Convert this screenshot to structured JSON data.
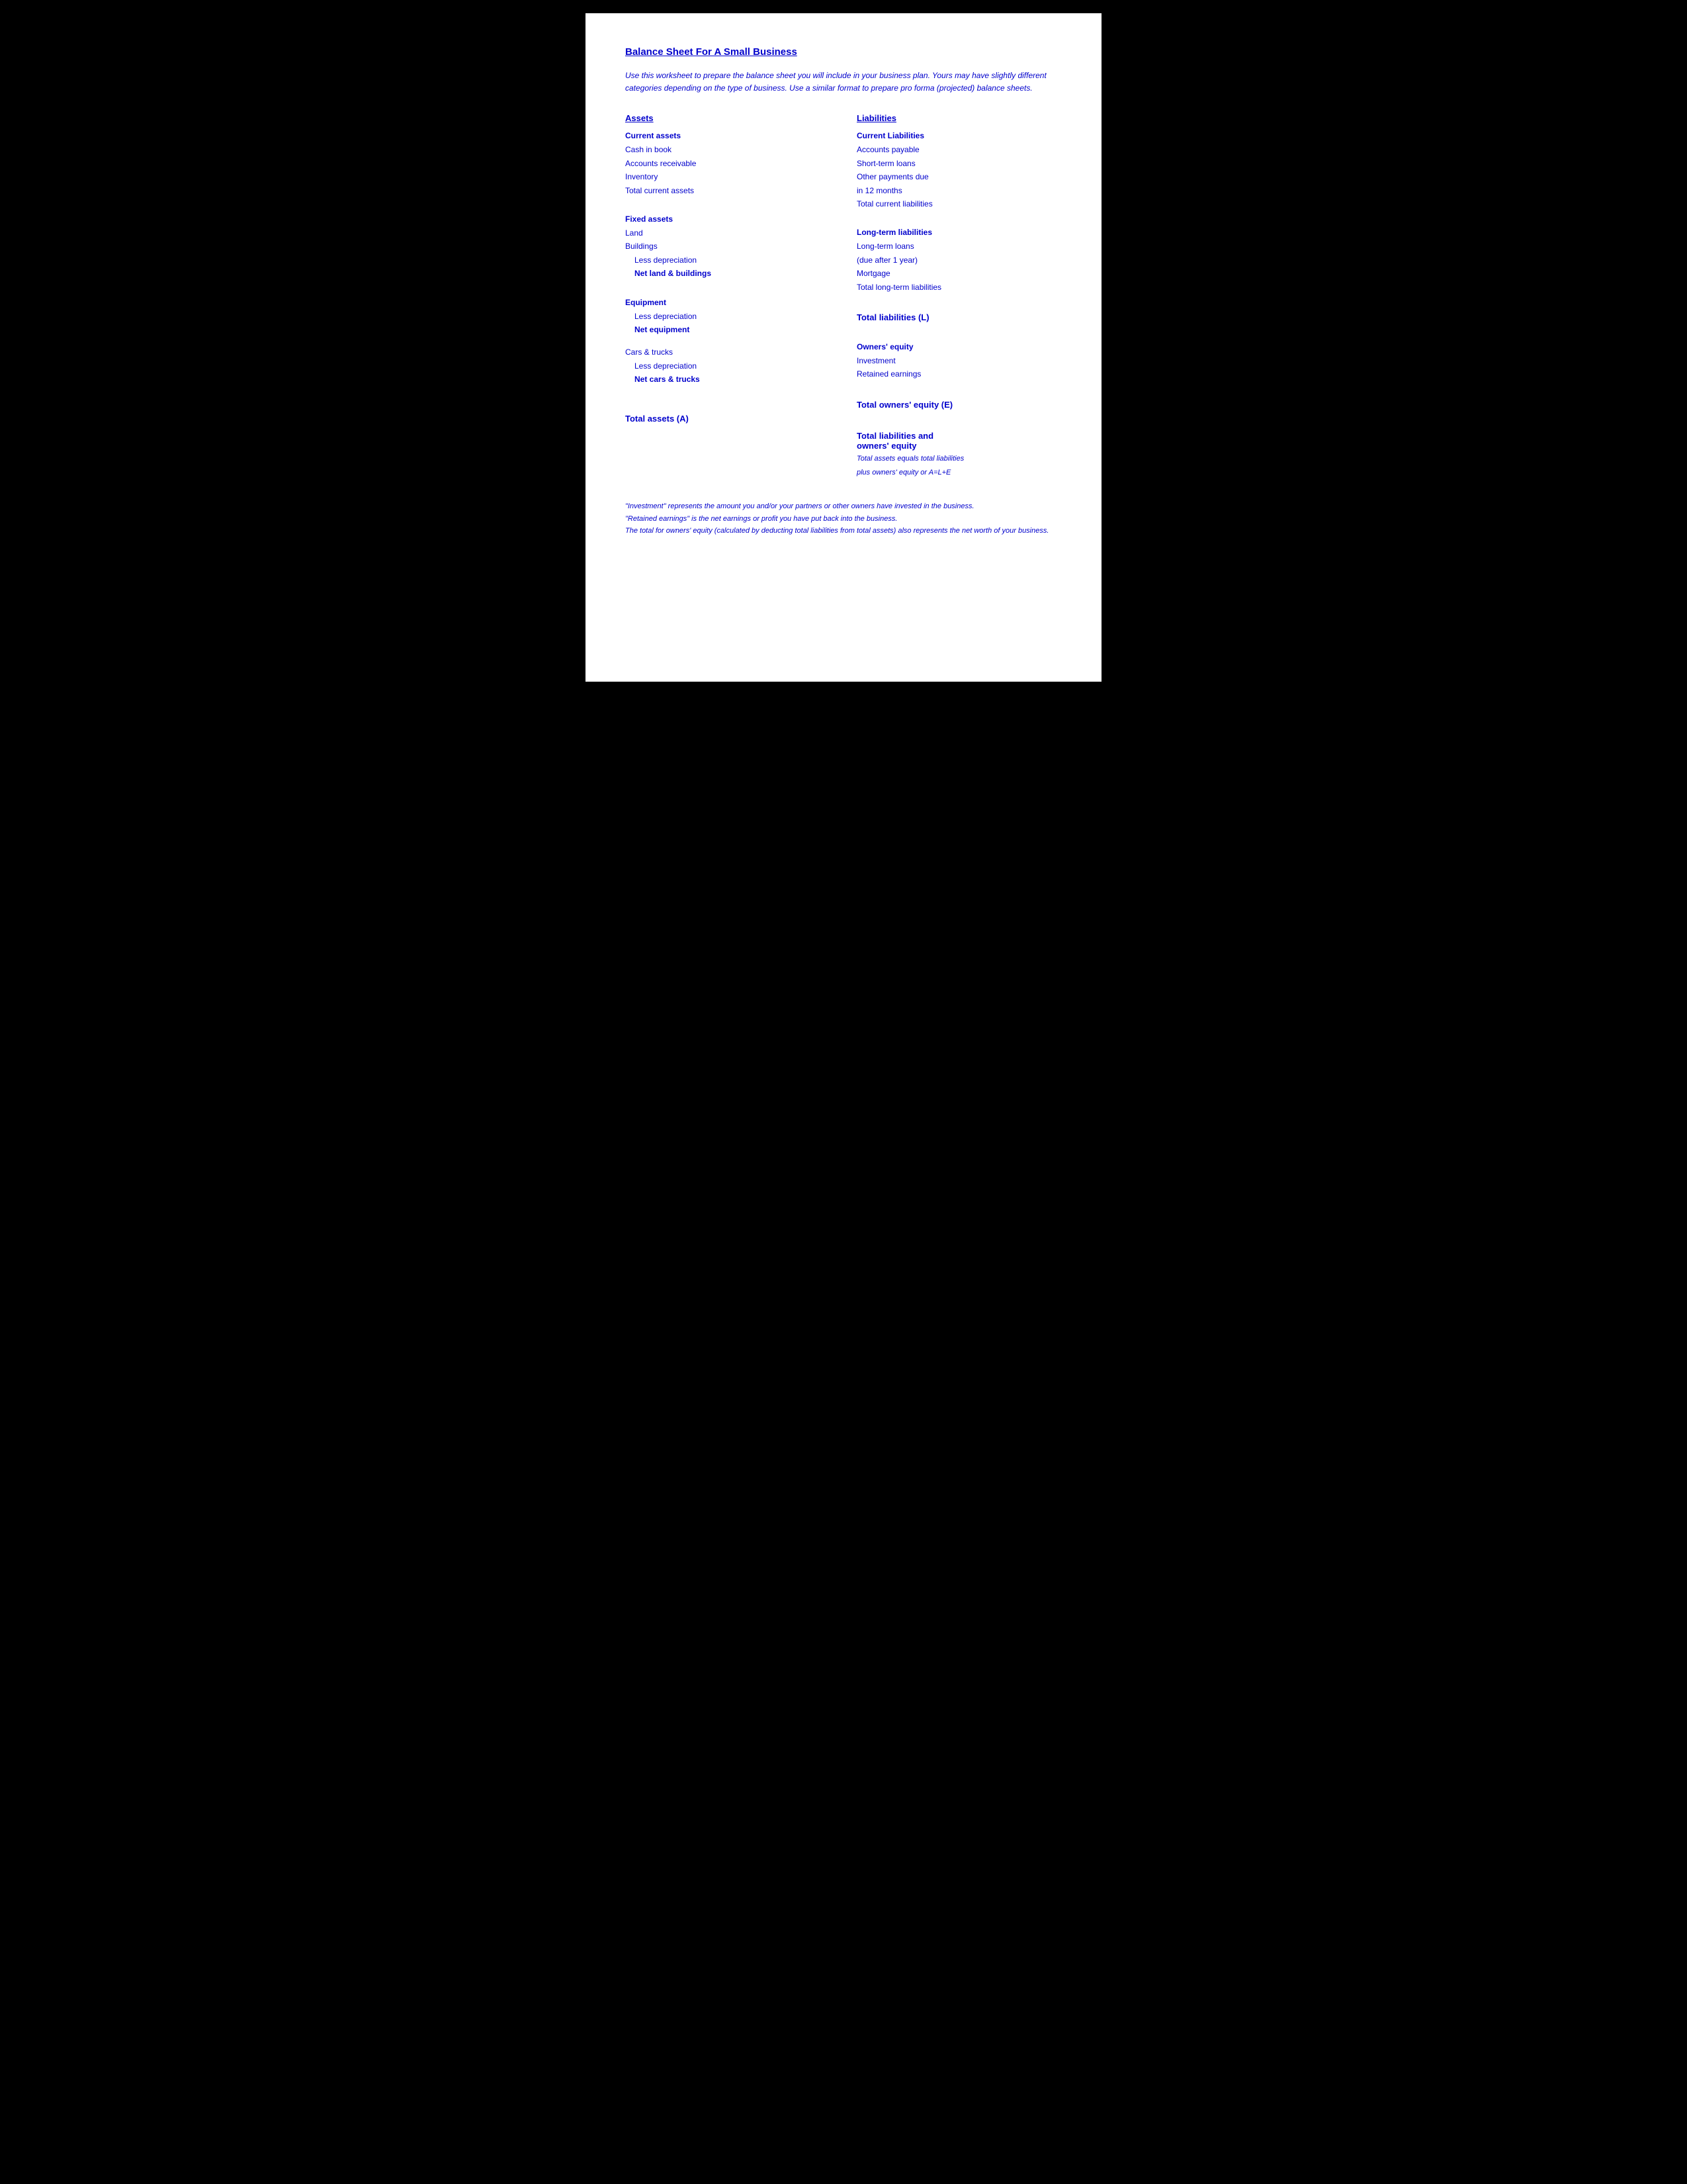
{
  "page": {
    "title": "Balance Sheet For A Small Business",
    "intro": "Use this worksheet to prepare the balance sheet you will include in your business plan.  Yours may have slightly different categories depending on the type of business.  Use a similar format to prepare pro forma (projected) balance sheets.",
    "assets_header": "Assets",
    "liabilities_header": "Liabilities",
    "left": {
      "current_assets_header": "Current assets",
      "cash_in_book": "Cash in book",
      "accounts_receivable": "Accounts receivable",
      "inventory": "Inventory",
      "total_current_assets": "Total current assets",
      "fixed_assets_header": "Fixed assets",
      "land": "Land",
      "buildings": "Buildings",
      "less_depreciation_buildings": "Less depreciation",
      "net_land_buildings": "Net land & buildings",
      "equipment_header": "Equipment",
      "less_depreciation_equipment": "Less depreciation",
      "net_equipment": "Net equipment",
      "cars_trucks_header": "Cars & trucks",
      "less_depreciation_cars": "Less depreciation",
      "net_cars_trucks": "Net cars & trucks",
      "total_assets": "Total assets (A)"
    },
    "right": {
      "current_liabilities_header": "Current Liabilities",
      "accounts_payable": "Accounts payable",
      "short_term_loans": "Short-term loans",
      "other_payments_due": "Other payments due",
      "in_12_months": " in 12 months",
      "total_current_liabilities": "Total current liabilities",
      "long_term_header": "Long-term liabilities",
      "long_term_loans": "Long-term loans",
      "due_after_1_year": " (due after 1 year)",
      "mortgage": "Mortgage",
      "total_long_term_liabilities": "Total long-term liabilities",
      "total_liabilities": "Total liabilities (L)",
      "owners_equity_header": "Owners' equity",
      "investment": "Investment",
      "retained_earnings": "Retained earnings",
      "total_owners_equity": "Total owners' equity (E)",
      "total_liabilities_and": "Total liabilities and",
      "owners_equity": " owners' equity",
      "total_assets_equals": "Total assets equals total liabilities",
      "plus_owners_equity": "plus owners' equity or A=L+E"
    },
    "footer": {
      "line1": "\"Investment\" represents the amount you and/or your partners or other owners have invested in the business.",
      "line2": "\"Retained earnings\" is the net earnings or profit you have put back into the business.",
      "line3": "The total for owners' equity (calculated by deducting total liabilities from total assets) also represents the net worth of your business."
    }
  }
}
